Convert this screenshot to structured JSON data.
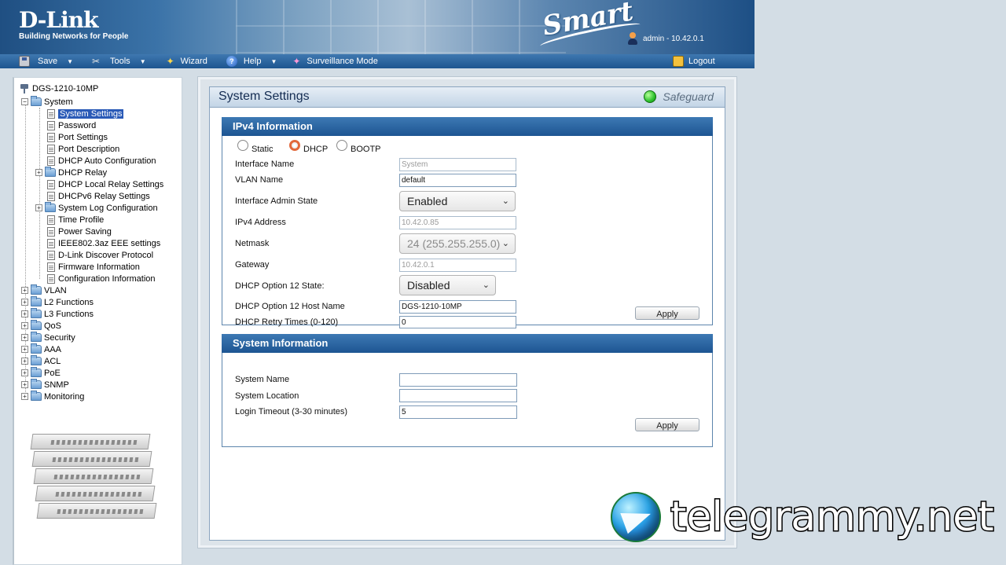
{
  "header": {
    "brand": "D-Link",
    "tagline": "Building Networks for People",
    "product": "Smart",
    "user": "admin - 10.42.0.1"
  },
  "menu": {
    "save": "Save",
    "tools": "Tools",
    "wizard": "Wizard",
    "help": "Help",
    "surveillance": "Surveillance Mode",
    "logout": "Logout"
  },
  "tree": {
    "root": "DGS-1210-10MP",
    "system": "System",
    "items": {
      "system_settings": "System Settings",
      "password": "Password",
      "port_settings": "Port Settings",
      "port_description": "Port Description",
      "dhcp_auto": "DHCP Auto Configuration",
      "dhcp_relay": "DHCP Relay",
      "dhcp_local_relay": "DHCP Local Relay Settings",
      "dhcpv6_relay": "DHCPv6 Relay Settings",
      "syslog": "System Log Configuration",
      "time_profile": "Time Profile",
      "power_saving": "Power Saving",
      "eee": "IEEE802.3az EEE settings",
      "discover": "D-Link Discover Protocol",
      "firmware": "Firmware Information",
      "config_info": "Configuration Information"
    },
    "folders": {
      "vlan": "VLAN",
      "l2": "L2 Functions",
      "l3": "L3 Functions",
      "qos": "QoS",
      "security": "Security",
      "aaa": "AAA",
      "acl": "ACL",
      "poe": "PoE",
      "snmp": "SNMP",
      "monitoring": "Monitoring"
    }
  },
  "page": {
    "title": "System Settings",
    "safeguard": "Safeguard"
  },
  "ipv4": {
    "heading": "IPv4 Information",
    "mode_static": "Static",
    "mode_dhcp": "DHCP",
    "mode_bootp": "BOOTP",
    "interface_name_label": "Interface Name",
    "interface_name_value": "System",
    "vlan_name_label": "VLAN Name",
    "vlan_name_value": "default",
    "admin_state_label": "Interface Admin State",
    "admin_state_value": "Enabled",
    "ipv4_address_label": "IPv4 Address",
    "ipv4_address_value": "10.42.0.85",
    "netmask_label": "Netmask",
    "netmask_value": "24 (255.255.255.0)",
    "gateway_label": "Gateway",
    "gateway_value": "10.42.0.1",
    "opt12_state_label": "DHCP Option 12 State:",
    "opt12_state_value": "Disabled",
    "opt12_host_label": "DHCP Option 12 Host Name",
    "opt12_host_value": "DGS-1210-10MP",
    "retry_label": "DHCP Retry Times (0-120)",
    "retry_value": "0",
    "apply": "Apply"
  },
  "sysinfo": {
    "heading": "System Information",
    "name_label": "System Name",
    "name_value": "",
    "location_label": "System Location",
    "location_value": "",
    "timeout_label": "Login Timeout (3-30 minutes)",
    "timeout_value": "5",
    "apply": "Apply"
  },
  "watermark": "telegrammy.net"
}
